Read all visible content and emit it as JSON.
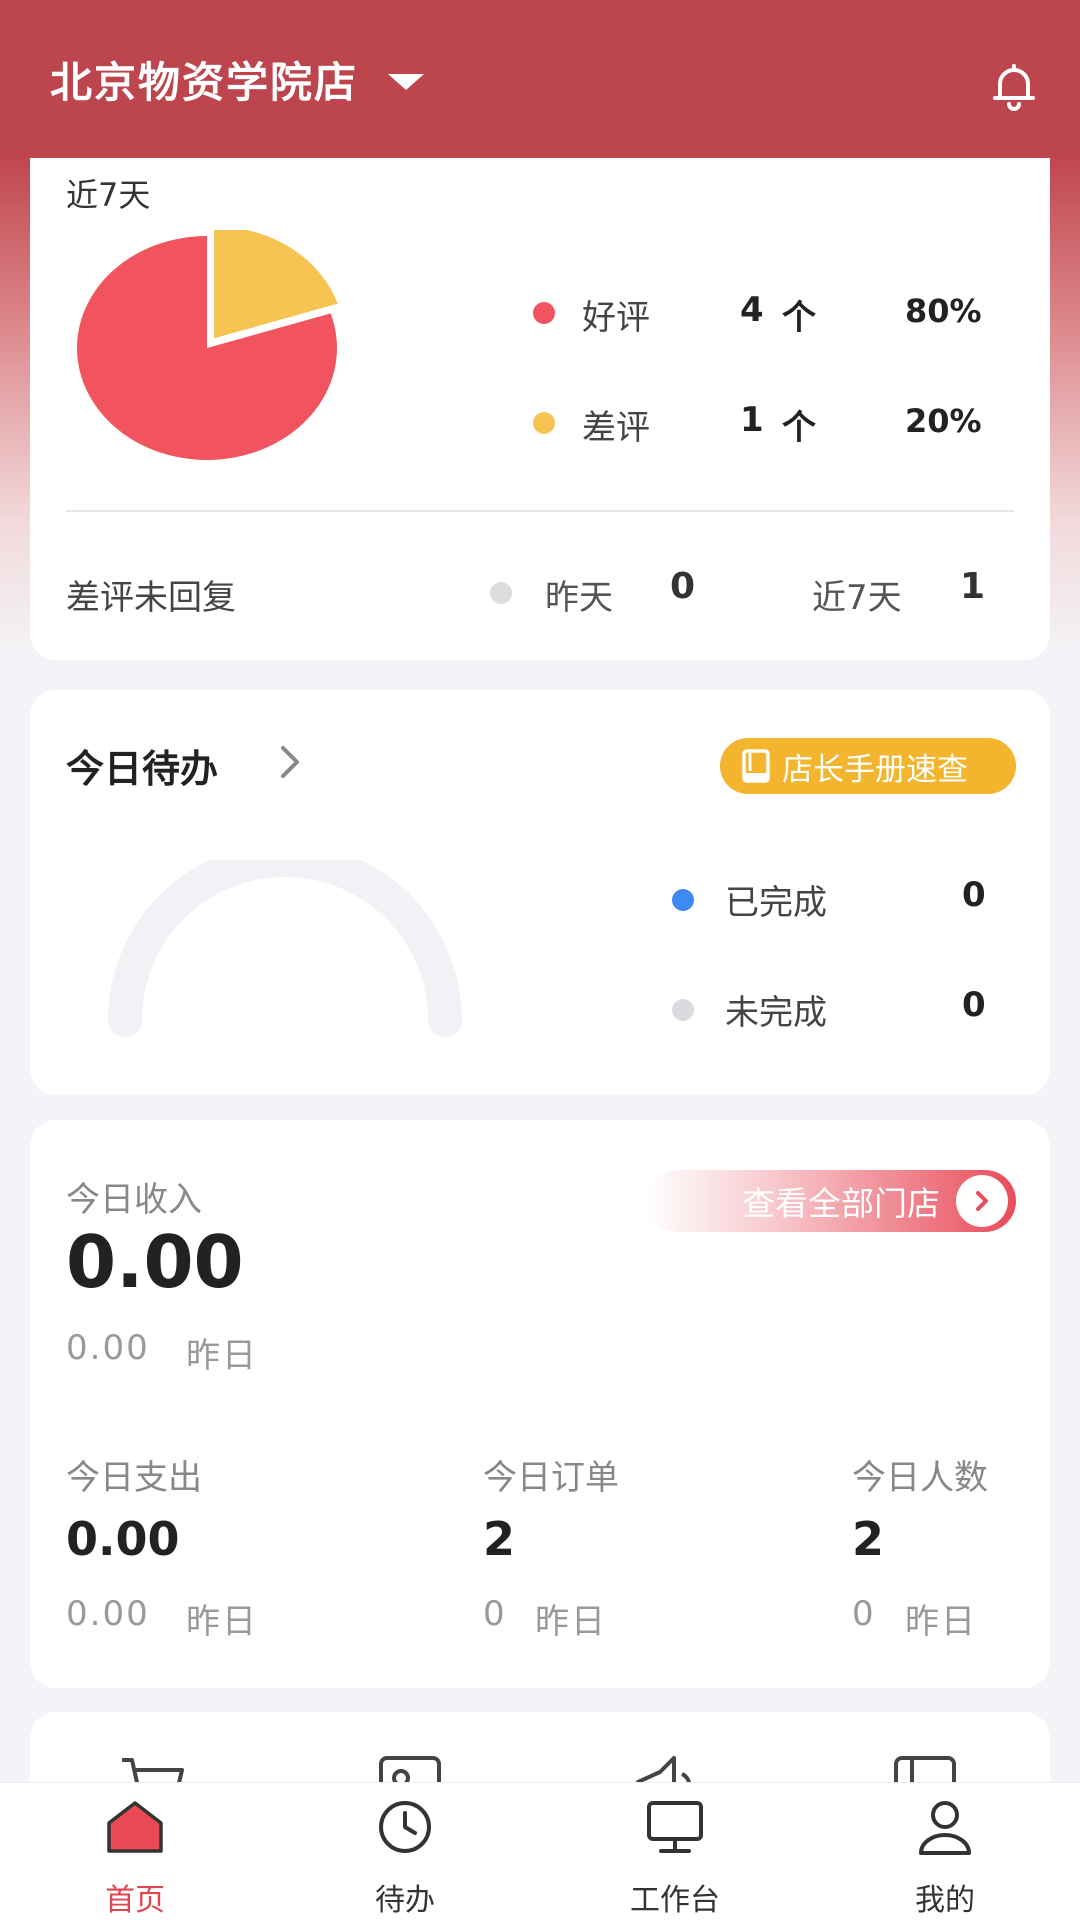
{
  "header": {
    "store_name": "北京物资学院店"
  },
  "reviews": {
    "period_label": "近7天",
    "items": [
      {
        "name": "好评",
        "count": "4",
        "unit": "个",
        "percent": "80%",
        "fraction": 0.8,
        "color": "#f2545f"
      },
      {
        "name": "差评",
        "count": "1",
        "unit": "个",
        "percent": "20%",
        "fraction": 0.2,
        "color": "#f7c454"
      }
    ],
    "unreplied": {
      "label": "差评未回复",
      "yesterday_label": "昨天",
      "yesterday_value": "0",
      "week_label": "近7天",
      "week_value": "1"
    }
  },
  "todo": {
    "title": "今日待办",
    "manual_button": "店长手册速查",
    "completed_label": "已完成",
    "completed_value": "0",
    "pending_label": "未完成",
    "pending_value": "0",
    "completed_color": "#3d8bf2",
    "pending_color": "#d9dbe0"
  },
  "income": {
    "label": "今日收入",
    "value": "0.00",
    "yesterday_value": "0.00",
    "yesterday_label": "昨日",
    "all_stores_button": "查看全部门店",
    "stats": [
      {
        "label": "今日支出",
        "value": "0.00",
        "yesterday_value": "0.00",
        "yesterday_label": "昨日"
      },
      {
        "label": "今日订单",
        "value": "2",
        "yesterday_value": "0",
        "yesterday_label": "昨日"
      },
      {
        "label": "今日人数",
        "value": "2",
        "yesterday_value": "0",
        "yesterday_label": "昨日"
      }
    ]
  },
  "tabbar": {
    "items": [
      {
        "label": "首页",
        "icon": "home-icon",
        "active": true
      },
      {
        "label": "待办",
        "icon": "clock-icon",
        "active": false
      },
      {
        "label": "工作台",
        "icon": "monitor-icon",
        "active": false
      },
      {
        "label": "我的",
        "icon": "user-icon",
        "active": false
      }
    ]
  },
  "colors": {
    "brand": "#bd464e",
    "accent_red": "#e0454f",
    "accent_yellow": "#f2b52d"
  }
}
